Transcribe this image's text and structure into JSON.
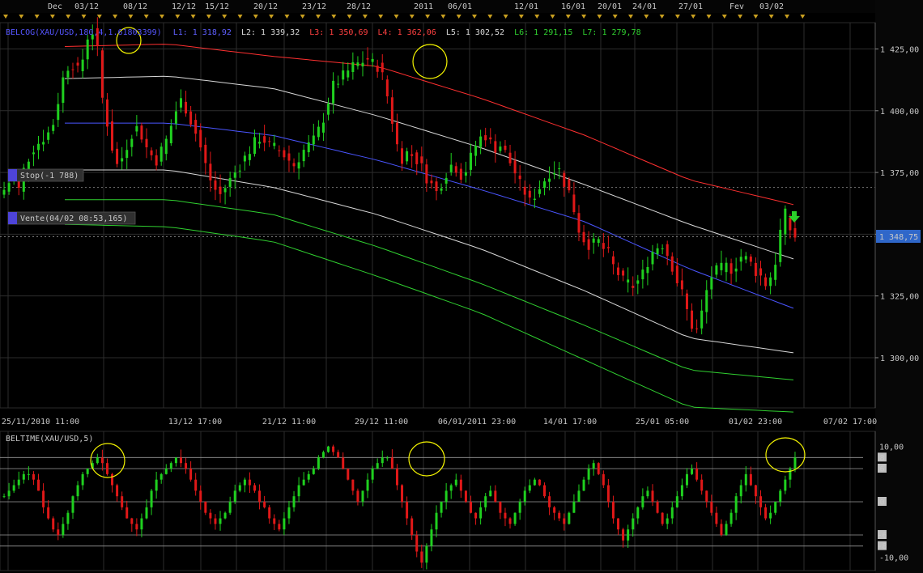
{
  "top_axis": {
    "labels": [
      "Dec",
      "03/12",
      "08/12",
      "12/12",
      "15/12",
      "20/12",
      "23/12",
      "28/12",
      "2011",
      "06/01",
      "12/01",
      "16/01",
      "20/01",
      "24/01",
      "27/01",
      "Fev",
      "03/02"
    ]
  },
  "main_panel": {
    "legend": {
      "indicator": "BELCOG(XAU/USD,180,4,1.61803399)",
      "levels": [
        {
          "label": "L1: 1 318,92",
          "color": "#5f5fff"
        },
        {
          "label": "L2: 1 339,32",
          "color": "#d8d8d8"
        },
        {
          "label": "L3: 1 350,69",
          "color": "#ff4040"
        },
        {
          "label": "L4: 1 362,06",
          "color": "#ff4040"
        },
        {
          "label": "L5: 1 302,52",
          "color": "#d8d8d8"
        },
        {
          "label": "L6: 1 291,15",
          "color": "#30d030"
        },
        {
          "label": "L7: 1 279,78",
          "color": "#30d030"
        }
      ]
    },
    "orders": {
      "stop_label": "Stop(-1 788)",
      "sell_label": "Vente(04/02 08:53,165)"
    },
    "last_price": "1 348,75",
    "colors": {
      "up": "#1fd01f",
      "down": "#e01818",
      "price_box": "#2f67c9"
    }
  },
  "bottom_axis": {
    "labels": [
      "25/11/2010 11:00",
      "13/12 17:00",
      "21/12 11:00",
      "29/12 11:00",
      "06/01/2011 23:00",
      "14/01 17:00",
      "25/01 05:00",
      "01/02 23:00",
      "07/02 17:00"
    ]
  },
  "sub_panel": {
    "title": "BELTIME(XAU/USD,5)",
    "level_labels": [
      "8",
      "6",
      "0",
      "-6",
      "-8"
    ]
  },
  "chart_data": [
    {
      "type": "candlestick",
      "name": "XAU/USD",
      "y_ticks": [
        "1 425,00",
        "1 400,00",
        "1 375,00",
        "1 350,00",
        "1 325,00",
        "1 300,00"
      ],
      "y_tick_values": [
        1425,
        1400,
        1375,
        1350,
        1325,
        1300
      ],
      "ylim": [
        1280,
        1435
      ],
      "x": [
        "25/11/2010 11:00",
        "07/02 17:00"
      ],
      "close": [
        1368,
        1371,
        1373,
        1368,
        1376,
        1381,
        1385,
        1387,
        1389,
        1391,
        1395,
        1404,
        1413,
        1418,
        1419,
        1416,
        1421,
        1430,
        1432,
        1424,
        1405,
        1395,
        1385,
        1378,
        1381,
        1386,
        1391,
        1393,
        1390,
        1385,
        1382,
        1380,
        1384,
        1388,
        1394,
        1400,
        1404,
        1401,
        1396,
        1391,
        1385,
        1378,
        1372,
        1368,
        1366,
        1369,
        1372,
        1375,
        1378,
        1381,
        1384,
        1387,
        1389,
        1388,
        1386,
        1385,
        1384,
        1382,
        1380,
        1378,
        1381,
        1384,
        1386,
        1388,
        1392,
        1397,
        1404,
        1410,
        1412,
        1414,
        1416,
        1418,
        1419,
        1420,
        1421,
        1419,
        1418,
        1414,
        1406,
        1396,
        1386,
        1381,
        1383,
        1382,
        1380,
        1377,
        1373,
        1370,
        1367,
        1371,
        1375,
        1378,
        1377,
        1374,
        1376,
        1381,
        1386,
        1389,
        1390,
        1387,
        1385,
        1386,
        1383,
        1379,
        1375,
        1370,
        1367,
        1363,
        1366,
        1369,
        1372,
        1375,
        1376,
        1376,
        1371,
        1367,
        1360,
        1352,
        1348,
        1346,
        1346,
        1347,
        1344,
        1342,
        1337,
        1334,
        1331,
        1330,
        1329,
        1331,
        1334,
        1339,
        1343,
        1345,
        1346,
        1342,
        1337,
        1331,
        1326,
        1319,
        1313,
        1311,
        1318,
        1327,
        1333,
        1335,
        1336,
        1337,
        1336,
        1338,
        1341,
        1340,
        1338,
        1335,
        1333,
        1330,
        1333,
        1339,
        1351,
        1358,
        1352,
        1349
      ],
      "reference_lines": [
        {
          "name": "Stop",
          "value": 1369
        },
        {
          "name": "Vente",
          "value": 1349
        }
      ],
      "channel_bands": [
        {
          "color": "#ff3030",
          "curve": [
            1426,
            1427,
            1422,
            1418,
            1405,
            1390,
            1372,
            1362
          ]
        },
        {
          "color": "#d8d8d8",
          "curve": [
            1413,
            1414,
            1409,
            1398,
            1385,
            1370,
            1354,
            1340
          ]
        },
        {
          "color": "#4a55ff",
          "curve": [
            1395,
            1395,
            1390,
            1380,
            1368,
            1355,
            1336,
            1320
          ]
        },
        {
          "color": "#d8d8d8",
          "curve": [
            1376,
            1376,
            1369,
            1358,
            1344,
            1327,
            1308,
            1302
          ]
        },
        {
          "color": "#30d030",
          "curve": [
            1364,
            1364,
            1358,
            1345,
            1330,
            1313,
            1295,
            1291
          ]
        },
        {
          "color": "#30d030",
          "curve": [
            1354,
            1353,
            1347,
            1333,
            1318,
            1299,
            1280,
            1278
          ]
        }
      ]
    },
    {
      "type": "bar",
      "name": "BELTIME(XAU/USD,5)",
      "y_ticks": [
        "10,00",
        "-10,00"
      ],
      "y_tick_values": [
        10,
        -10
      ],
      "ylim": [
        -12,
        12
      ],
      "levels": [
        8,
        6,
        0,
        -6,
        -8
      ],
      "values": [
        1,
        2,
        3,
        4,
        5,
        5,
        4,
        2,
        -1,
        -3,
        -5,
        -6,
        -4,
        -2,
        1,
        3,
        5,
        6,
        7,
        8,
        7,
        5,
        3,
        1,
        -1,
        -3,
        -4,
        -5,
        -3,
        -1,
        2,
        4,
        5,
        6,
        7,
        8,
        7,
        6,
        4,
        2,
        0,
        -2,
        -3,
        -4,
        -3,
        -2,
        0,
        2,
        3,
        4,
        3,
        2,
        0,
        -1,
        -3,
        -4,
        -5,
        -3,
        -1,
        1,
        3,
        4,
        5,
        6,
        8,
        9,
        10,
        9,
        8,
        6,
        4,
        2,
        0,
        2,
        4,
        6,
        7,
        8,
        8,
        6,
        3,
        0,
        -3,
        -6,
        -9,
        -11,
        -8,
        -5,
        -2,
        0,
        2,
        3,
        4,
        2,
        0,
        -2,
        -3,
        -1,
        1,
        2,
        0,
        -2,
        -3,
        -4,
        -2,
        0,
        2,
        3,
        4,
        3,
        1,
        -1,
        -2,
        -3,
        -4,
        -2,
        0,
        2,
        4,
        6,
        7,
        5,
        3,
        0,
        -3,
        -5,
        -7,
        -5,
        -3,
        -1,
        1,
        2,
        0,
        -2,
        -4,
        -3,
        -1,
        1,
        3,
        5,
        6,
        4,
        2,
        0,
        -2,
        -4,
        -6,
        -4,
        -2,
        1,
        3,
        5,
        3,
        1,
        -1,
        -3,
        -2,
        0,
        2,
        4,
        6,
        8
      ]
    }
  ]
}
